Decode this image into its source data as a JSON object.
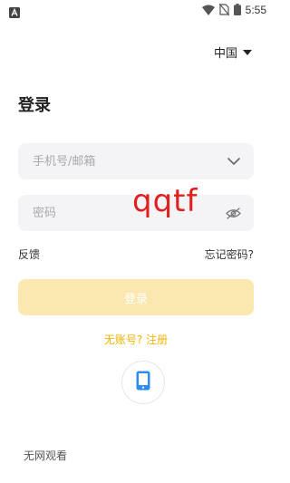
{
  "status_bar": {
    "time": "5:55",
    "icons": [
      "notification-a-icon",
      "wifi-icon",
      "no-sim-icon",
      "battery-icon"
    ]
  },
  "region": {
    "label": "中国",
    "icon": "triangle-down-icon"
  },
  "title": "登录",
  "account_field": {
    "placeholder": "手机号/邮箱",
    "value": "",
    "icon": "chevron-down-icon"
  },
  "password_field": {
    "placeholder": "密码",
    "value": "",
    "icon": "eye-hidden-icon"
  },
  "overlay_text": "qqtf",
  "feedback_label": "反馈",
  "forgot_password_label": "忘记密码?",
  "login_button_label": "登录",
  "register_link_label": "无账号? 注册",
  "phone_login_icon": "smartphone-icon",
  "offline_label": "无网观看",
  "colors": {
    "accent": "#f0b400",
    "login_button_bg": "#fbe7b0",
    "phone_icon": "#2d8cf0",
    "overlay_text": "#e0201f"
  }
}
